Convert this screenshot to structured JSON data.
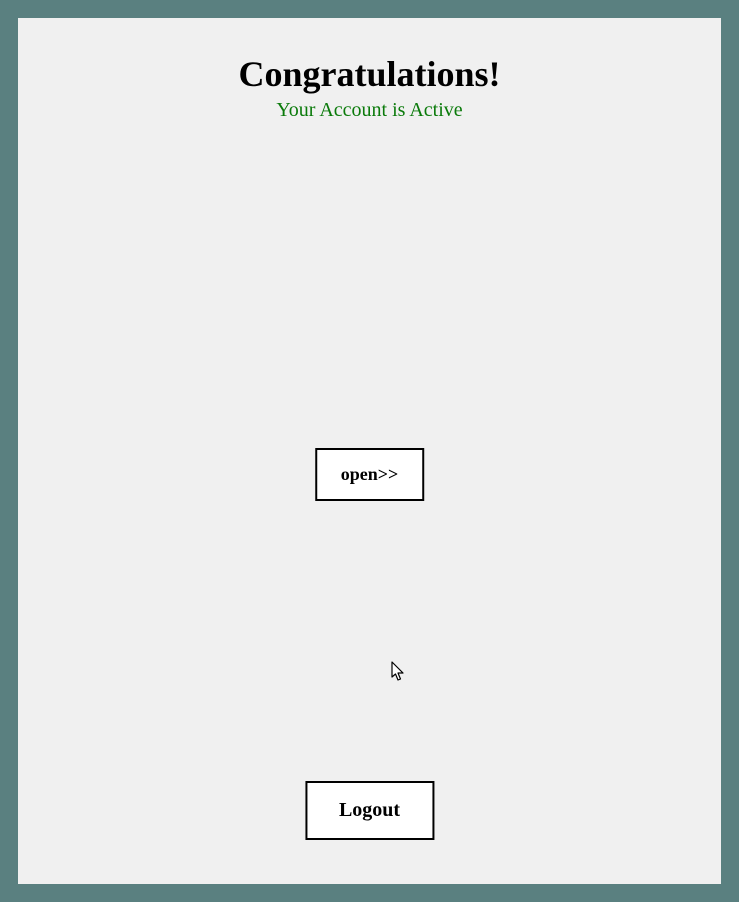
{
  "header": {
    "title": "Congratulations!",
    "subtitle": "Your Account is Active"
  },
  "mail": {
    "open_label": "open>>"
  },
  "footer": {
    "logout_label": "Logout"
  },
  "colors": {
    "frame": "#5a8080",
    "panel": "#f0f0f0",
    "status_text": "#0a7a0a",
    "brand_blue_light": "#3a6af8",
    "brand_blue_dark": "#1a30f0"
  }
}
